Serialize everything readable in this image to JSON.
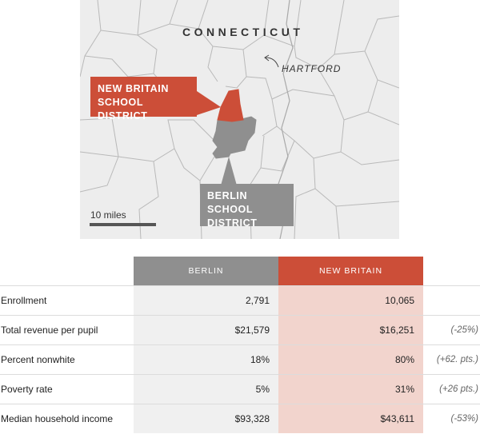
{
  "map": {
    "state_label": "CONNECTICUT",
    "city_label": "HARTFORD",
    "callout_new_britain": [
      "NEW BRITAIN",
      "SCHOOL DISTRICT"
    ],
    "callout_berlin": [
      "BERLIN SCHOOL",
      "DISTRICT"
    ],
    "scale_label": "10 miles",
    "colors": {
      "background": "#ededed",
      "town_lines": "#b9b9b9",
      "new_britain": "#cc4e38",
      "berlin": "#8f8f8f"
    }
  },
  "table": {
    "headers": {
      "berlin": "BERLIN",
      "new_britain": "NEW BRITAIN"
    },
    "rows": [
      {
        "label": "Enrollment",
        "berlin": "2,791",
        "new_britain": "10,065",
        "change": ""
      },
      {
        "label": "Total revenue per pupil",
        "berlin": "$21,579",
        "new_britain": "$16,251",
        "change": "(-25%)"
      },
      {
        "label": "Percent nonwhite",
        "berlin": "18%",
        "new_britain": "80%",
        "change": "(+62. pts.)"
      },
      {
        "label": "Poverty rate",
        "berlin": "5%",
        "new_britain": "31%",
        "change": "(+26 pts.)"
      },
      {
        "label": "Median household income",
        "berlin": "$93,328",
        "new_britain": "$43,611",
        "change": "(-53%)"
      }
    ],
    "colors": {
      "berlin_header": "#8f8f8f",
      "new_britain_header": "#cc4e38",
      "berlin_cell": "#f0f0f0",
      "new_britain_cell": "#f2d4cd"
    }
  }
}
